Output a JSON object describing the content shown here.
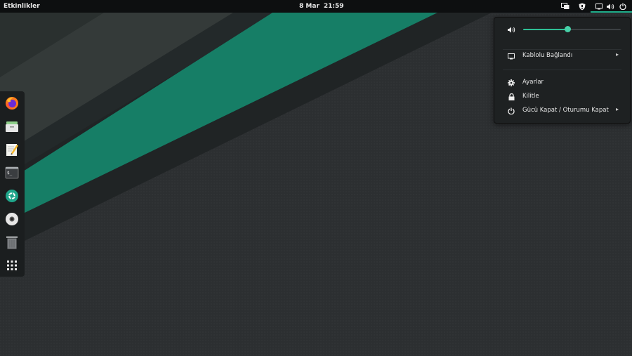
{
  "topbar": {
    "activities_label": "Etkinlikler",
    "date": "8 Mar",
    "time": "21:59",
    "tray_icons": [
      "display-switch-icon",
      "shield-icon",
      "network-wired-icon",
      "volume-icon",
      "power-icon"
    ]
  },
  "dock": {
    "items": [
      "firefox-icon",
      "file-manager-icon",
      "text-editor-icon",
      "terminal-icon",
      "camera-app-icon",
      "disc-icon",
      "trash-icon",
      "show-apps-grid-icon"
    ]
  },
  "system_menu": {
    "volume": {
      "icon": "volume-icon",
      "level": 0.45
    },
    "network": {
      "icon": "network-wired-icon",
      "label": "Kablolu Bağlandı"
    },
    "settings": {
      "icon": "gear-icon",
      "label": "Ayarlar"
    },
    "lock": {
      "icon": "lock-icon",
      "label": "Kilitle"
    },
    "power": {
      "icon": "power-icon",
      "label": "Gücü Kapat / Oturumu Kapat"
    }
  },
  "colors": {
    "accent": "#1fae8a",
    "wallpaper_green": "#167e66",
    "panel": "#0d0f10"
  }
}
